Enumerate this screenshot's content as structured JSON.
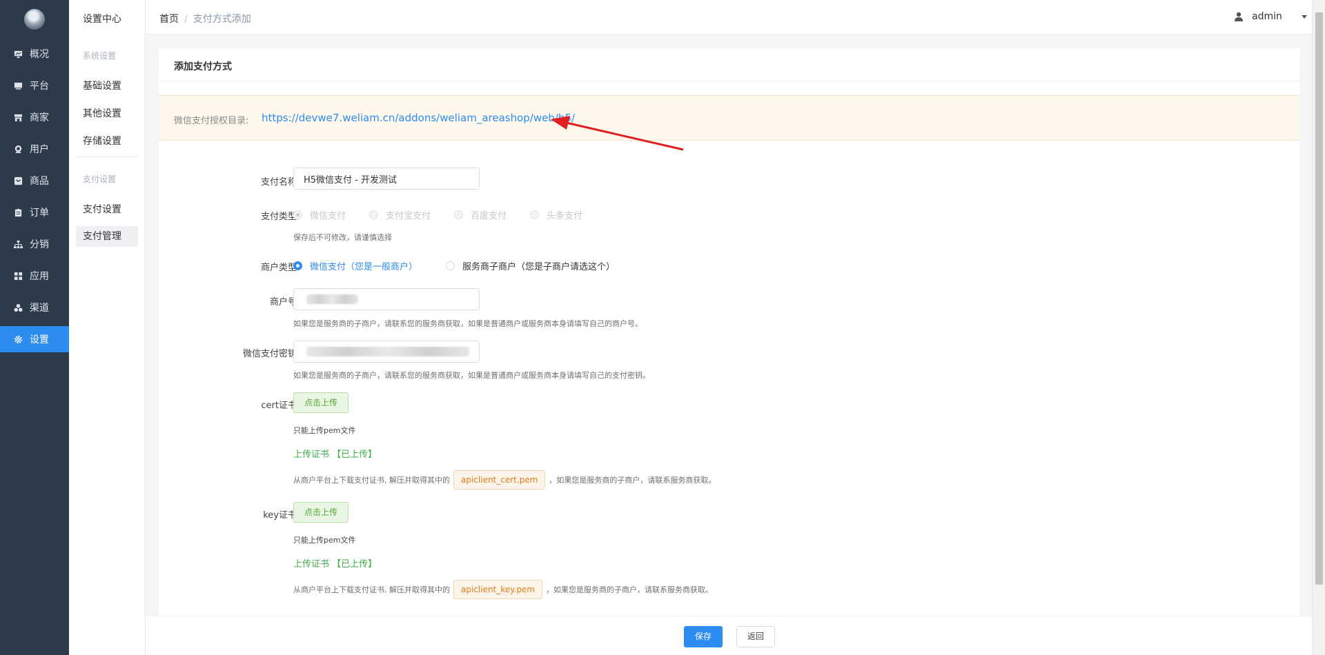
{
  "sidebar": {
    "items": [
      {
        "label": "概况",
        "icon": "monitor-icon"
      },
      {
        "label": "平台",
        "icon": "desktop-icon"
      },
      {
        "label": "商家",
        "icon": "store-icon"
      },
      {
        "label": "用户",
        "icon": "user-icon"
      },
      {
        "label": "商品",
        "icon": "goods-icon"
      },
      {
        "label": "订单",
        "icon": "clipboard-icon"
      },
      {
        "label": "分销",
        "icon": "sitemap-icon"
      },
      {
        "label": "应用",
        "icon": "grid-icon"
      },
      {
        "label": "渠道",
        "icon": "cubes-icon"
      },
      {
        "label": "设置",
        "icon": "gear-icon",
        "active": true
      }
    ]
  },
  "subnav": {
    "title": "设置中心",
    "groups": [
      {
        "label": "系统设置",
        "links": [
          "基础设置",
          "其他设置",
          "存储设置"
        ]
      },
      {
        "label": "支付设置",
        "links": [
          "支付设置",
          "支付管理"
        ]
      }
    ],
    "active": "支付管理"
  },
  "header": {
    "breadcrumb_home": "首页",
    "breadcrumb_sep": "/",
    "breadcrumb_current": "支付方式添加",
    "username": "admin"
  },
  "card": {
    "title": "添加支付方式",
    "notice_label": "微信支付授权目录:",
    "notice_url": "https://devwe7.weliam.cn/addons/weliam_areashop/web/h5/"
  },
  "form": {
    "pay_name": {
      "label": "支付名称",
      "value": "H5微信支付 - 开发测试"
    },
    "pay_type": {
      "label": "支付类型",
      "options": [
        "微信支付",
        "支付宝支付",
        "百度支付",
        "头条支付"
      ],
      "hint": "保存后不可修改，请谨慎选择"
    },
    "merchant_type": {
      "label": "商户类型",
      "options": [
        "微信支付（您是一般商户）",
        "服务商子商户（您是子商户请选这个）"
      ]
    },
    "merchant_no": {
      "label": "商户号",
      "hint": "如果您是服务商的子商户，请联系您的服务商获取，如果是普通商户或服务商本身请填写自己的商户号。"
    },
    "secret": {
      "label": "微信支付密钥",
      "hint": "如果您是服务商的子商户，请联系您的服务商获取，如果是普通商户或服务商本身请填写自己的支付密钥。"
    },
    "cert": {
      "label": "cert证书",
      "upload": "点击上传",
      "only": "只能上传pem文件",
      "status": "上传证书 【已上传】",
      "desc_pre": "从商户平台上下载支付证书, 解压并取得其中的",
      "file": "apiclient_cert.pem",
      "desc_post": "，如果您是服务商的子商户，请联系服务商获取。"
    },
    "key": {
      "label": "key证书",
      "upload": "点击上传",
      "only": "只能上传pem文件",
      "status": "上传证书 【已上传】",
      "desc_pre": "从商户平台上下载支付证书, 解压并取得其中的",
      "file": "apiclient_key.pem",
      "desc_post": "，如果您是服务商的子商户，请联系服务商获取。"
    }
  },
  "footer": {
    "save": "保存",
    "back": "返回"
  },
  "colors": {
    "primary": "#2d8cf0",
    "sidebar": "#2c3a4a",
    "success": "#3fae49",
    "warning_bg": "#fef7eb",
    "arrow": "#e02020"
  }
}
